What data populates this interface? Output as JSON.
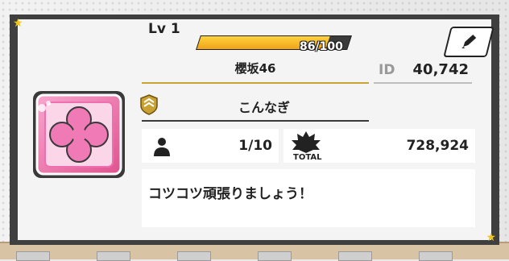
{
  "profile": {
    "level_label": "Lv 1",
    "exp_text": "86/100",
    "exp_current": 86,
    "exp_max": 100,
    "group_name": "櫻坂46",
    "id_label": "ID",
    "id_value": "40,742",
    "nickname": "こんなぎ",
    "member_count": "1/10",
    "total_label": "TOTAL",
    "total_value": "728,924",
    "comment": "コツコツ頑張りましょう！"
  },
  "colors": {
    "exp_bar": "#f7b42a",
    "card_border": "#3f3f3f",
    "accent_gold": "#c8a233",
    "emblem_pink": "#f06fb0"
  },
  "icons": {
    "edit": "pencil-icon",
    "member": "person-icon",
    "total": "starburst-icon",
    "rank": "rank-badge-icon",
    "emblem": "clover-emblem"
  }
}
